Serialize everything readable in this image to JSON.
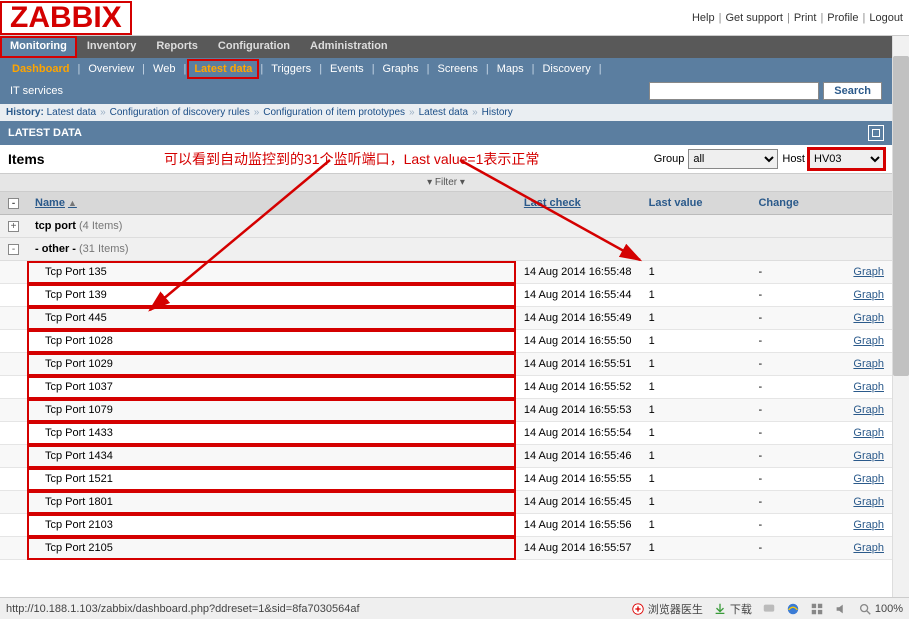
{
  "logo": "ZABBIX",
  "toplinks": [
    "Help",
    "Get support",
    "Print",
    "Profile",
    "Logout"
  ],
  "nav1": [
    {
      "label": "Monitoring",
      "active": true
    },
    {
      "label": "Inventory"
    },
    {
      "label": "Reports"
    },
    {
      "label": "Configuration"
    },
    {
      "label": "Administration"
    }
  ],
  "nav2": [
    {
      "label": "Dashboard",
      "style": "highlight"
    },
    {
      "label": "Overview"
    },
    {
      "label": "Web"
    },
    {
      "label": "Latest data",
      "style": "highlight red-box"
    },
    {
      "label": "Triggers"
    },
    {
      "label": "Events"
    },
    {
      "label": "Graphs"
    },
    {
      "label": "Screens"
    },
    {
      "label": "Maps"
    },
    {
      "label": "Discovery"
    }
  ],
  "nav3": {
    "label": "IT services"
  },
  "search_button": "Search",
  "history": {
    "prefix": "History:",
    "crumbs": [
      "Latest data",
      "Configuration of discovery rules",
      "Configuration of item prototypes",
      "Latest data",
      "History"
    ]
  },
  "section_title": "LATEST DATA",
  "items_title": "Items",
  "annotation": "可以看到自动监控到的31个监听端口，Last value=1表示正常",
  "filters": {
    "group_label": "Group",
    "group_value": "all",
    "host_label": "Host",
    "host_value": "HV03"
  },
  "filter_label": "Filter",
  "columns": {
    "name": "Name",
    "last_check": "Last check",
    "last_value": "Last value",
    "change": "Change",
    "action": ""
  },
  "groups": [
    {
      "expander": "+",
      "label": "tcp port",
      "count": "(4 Items)"
    },
    {
      "expander": "-",
      "label": "- other -",
      "count": "(31 Items)"
    }
  ],
  "rows": [
    {
      "name": "Tcp Port 135",
      "last_check": "14 Aug 2014 16:55:48",
      "last_value": "1",
      "change": "-",
      "action": "Graph"
    },
    {
      "name": "Tcp Port 139",
      "last_check": "14 Aug 2014 16:55:44",
      "last_value": "1",
      "change": "-",
      "action": "Graph"
    },
    {
      "name": "Tcp Port 445",
      "last_check": "14 Aug 2014 16:55:49",
      "last_value": "1",
      "change": "-",
      "action": "Graph"
    },
    {
      "name": "Tcp Port 1028",
      "last_check": "14 Aug 2014 16:55:50",
      "last_value": "1",
      "change": "-",
      "action": "Graph"
    },
    {
      "name": "Tcp Port 1029",
      "last_check": "14 Aug 2014 16:55:51",
      "last_value": "1",
      "change": "-",
      "action": "Graph"
    },
    {
      "name": "Tcp Port 1037",
      "last_check": "14 Aug 2014 16:55:52",
      "last_value": "1",
      "change": "-",
      "action": "Graph"
    },
    {
      "name": "Tcp Port 1079",
      "last_check": "14 Aug 2014 16:55:53",
      "last_value": "1",
      "change": "-",
      "action": "Graph"
    },
    {
      "name": "Tcp Port 1433",
      "last_check": "14 Aug 2014 16:55:54",
      "last_value": "1",
      "change": "-",
      "action": "Graph"
    },
    {
      "name": "Tcp Port 1434",
      "last_check": "14 Aug 2014 16:55:46",
      "last_value": "1",
      "change": "-",
      "action": "Graph"
    },
    {
      "name": "Tcp Port 1521",
      "last_check": "14 Aug 2014 16:55:55",
      "last_value": "1",
      "change": "-",
      "action": "Graph"
    },
    {
      "name": "Tcp Port 1801",
      "last_check": "14 Aug 2014 16:55:45",
      "last_value": "1",
      "change": "-",
      "action": "Graph"
    },
    {
      "name": "Tcp Port 2103",
      "last_check": "14 Aug 2014 16:55:56",
      "last_value": "1",
      "change": "-",
      "action": "Graph"
    },
    {
      "name": "Tcp Port 2105",
      "last_check": "14 Aug 2014 16:55:57",
      "last_value": "1",
      "change": "-",
      "action": "Graph"
    }
  ],
  "status_url": "http://10.188.1.103/zabbix/dashboard.php?ddreset=1&sid=8fa7030564af",
  "status_right": {
    "doctor": "浏览器医生",
    "download": "下载",
    "zoom": "100%"
  }
}
